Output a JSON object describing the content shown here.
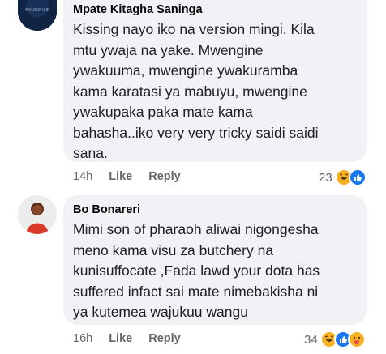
{
  "comments": [
    {
      "author": "Mpate Kitagha Saninga",
      "text": "Kissing nayo iko na version mingi. Kila\nmtu ywaja na yake. Mwengine\nywakuuma, mwengine ywakuramba\nkama karatasi ya mabuyu, mwengine\nywakupaka paka mate kama\nbahasha..iko very very tricky saidi saidi\nsana.",
      "time": "14h",
      "like_label": "Like",
      "reply_label": "Reply",
      "reaction_count": "23",
      "reactions": [
        "haha-icon",
        "like-icon"
      ],
      "avatar_text": "FOCUS ON GOD"
    },
    {
      "author": "Bo Bonareri",
      "text": "Mimi son of pharaoh aliwai nigongesha\nmeno kama visu za butchery na\nkunisuffocate ,Fada lawd your dota has\nsuffered infact sai mate nimebakisha ni\nya kutemea wajukuu wangu",
      "time": "16h",
      "like_label": "Like",
      "reply_label": "Reply",
      "reaction_count": "34",
      "reactions": [
        "haha-icon",
        "like-icon",
        "care-icon"
      ]
    }
  ],
  "colors": {
    "bubble": "#f0f2f5",
    "meta": "#65676b",
    "like_blue": "#1877f2",
    "haha_yellow": "#f7b125"
  }
}
